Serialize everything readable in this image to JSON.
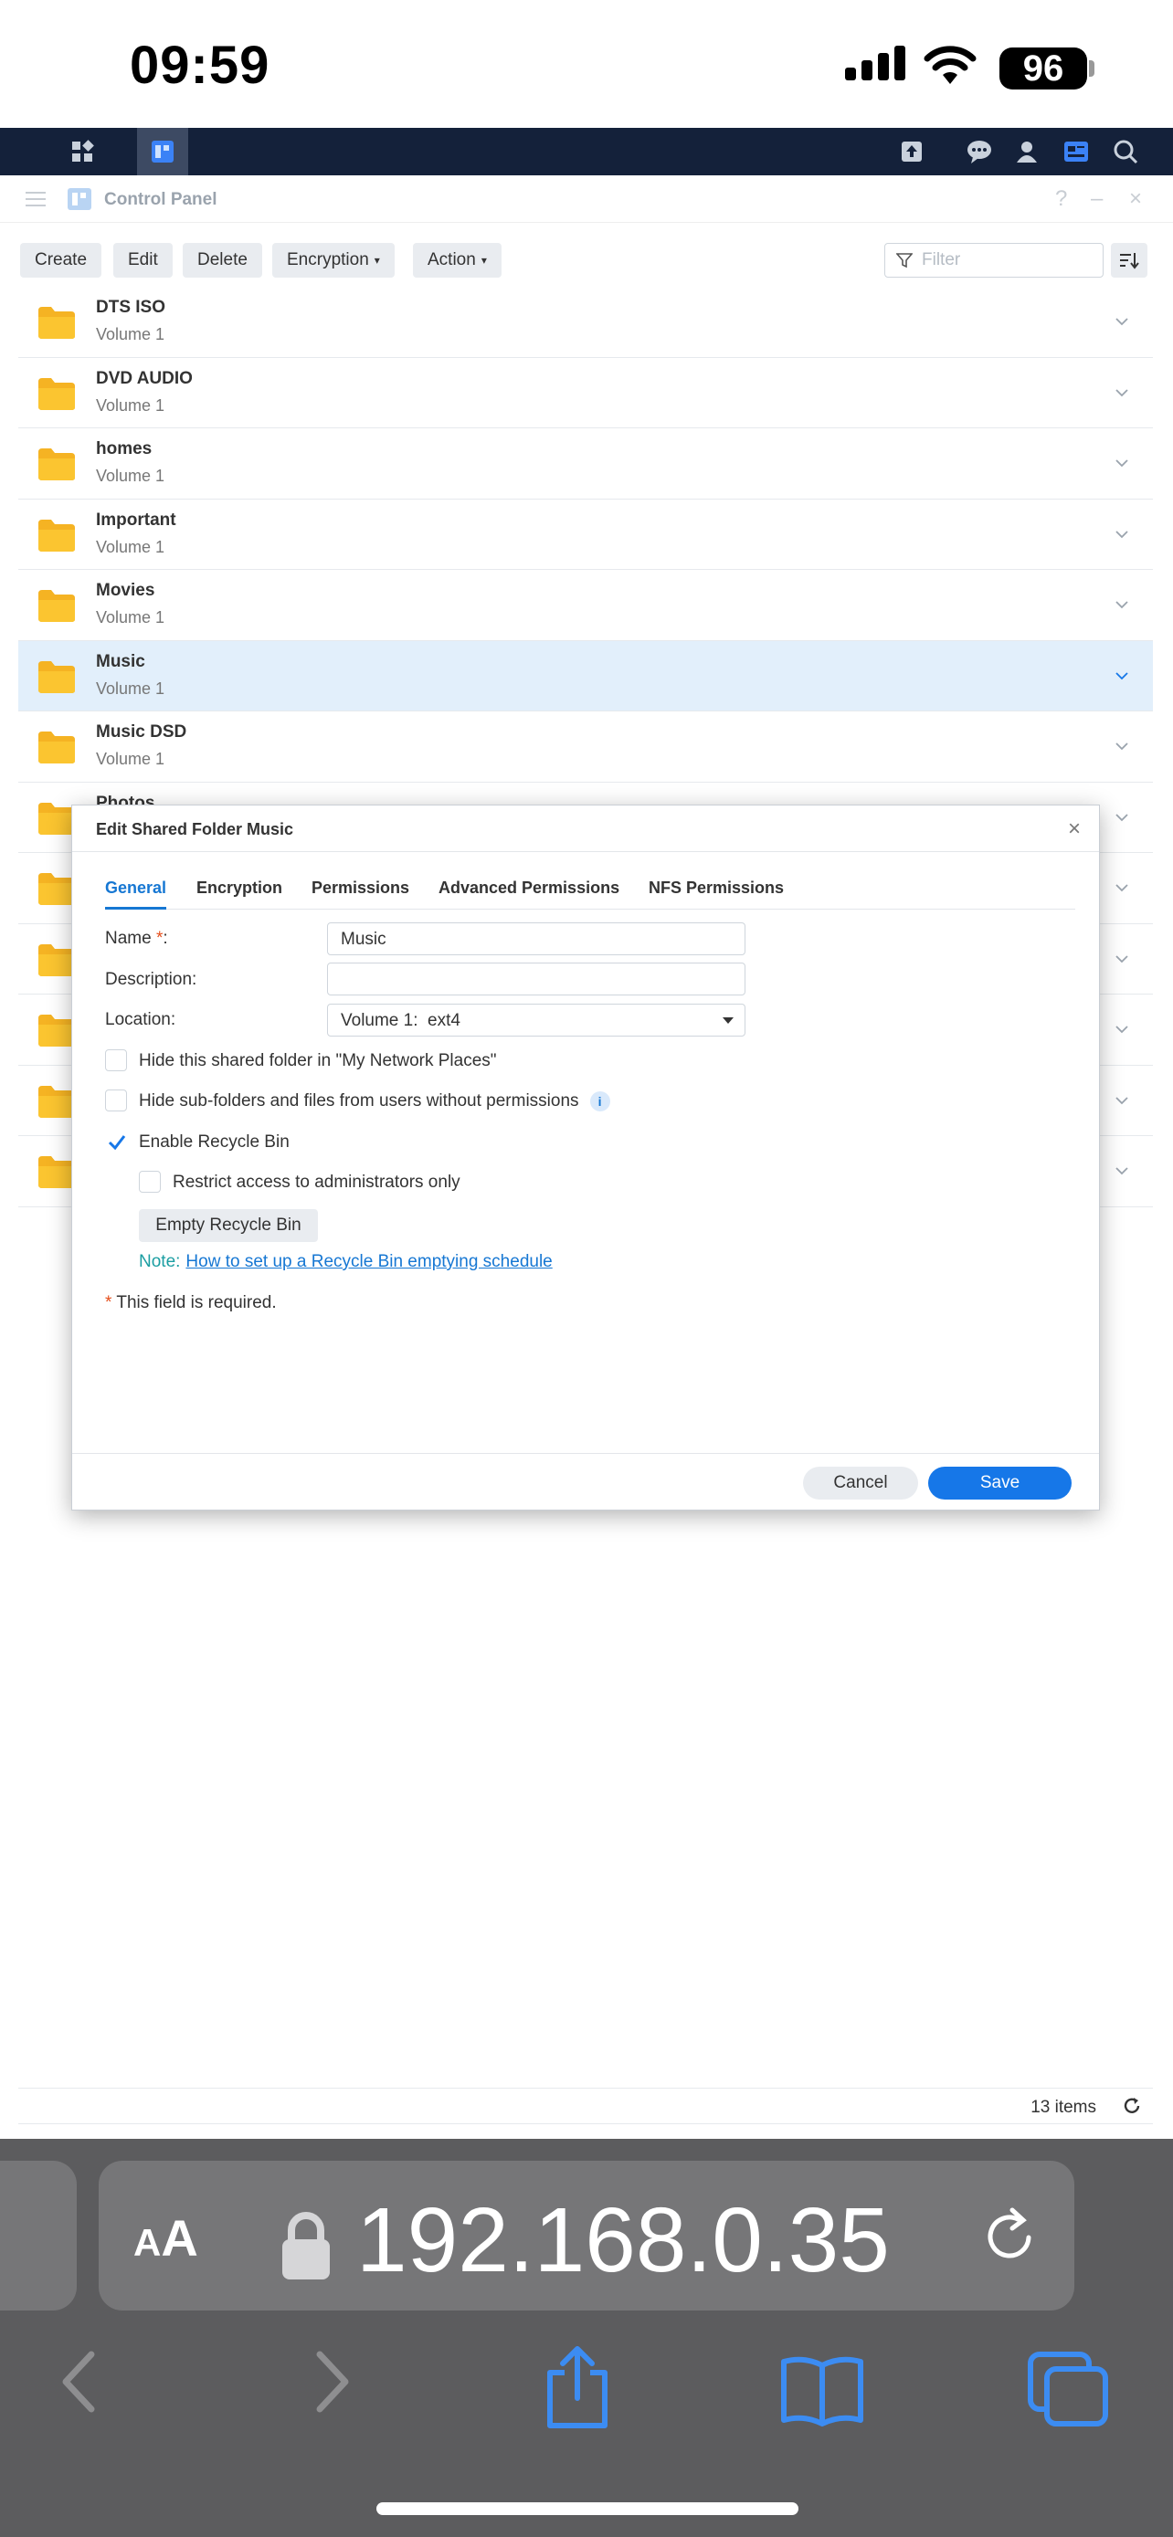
{
  "status_bar": {
    "time": "09:59",
    "battery": "96"
  },
  "control_panel": {
    "title": "Control Panel",
    "toolbar": {
      "create": "Create",
      "edit": "Edit",
      "delete": "Delete",
      "encryption": "Encryption",
      "action": "Action",
      "filter_placeholder": "Filter"
    },
    "folders": [
      {
        "name": "DTS ISO",
        "volume": "Volume 1"
      },
      {
        "name": "DVD AUDIO",
        "volume": "Volume 1"
      },
      {
        "name": "homes",
        "volume": "Volume 1"
      },
      {
        "name": "Important",
        "volume": "Volume 1"
      },
      {
        "name": "Movies",
        "volume": "Volume 1"
      },
      {
        "name": "Music",
        "volume": "Volume 1",
        "selected": true
      },
      {
        "name": "Music DSD",
        "volume": "Volume 1"
      },
      {
        "name": "Photos",
        "volume": ""
      },
      {
        "name": "",
        "volume": ""
      },
      {
        "name": "",
        "volume": ""
      },
      {
        "name": "",
        "volume": ""
      },
      {
        "name": "",
        "volume": ""
      },
      {
        "name": "",
        "volume": ""
      }
    ],
    "item_count": "13 items"
  },
  "dialog": {
    "title": "Edit Shared Folder Music",
    "tabs": [
      "General",
      "Encryption",
      "Permissions",
      "Advanced Permissions",
      "NFS Permissions"
    ],
    "active_tab": "General",
    "fields": {
      "name_label": "Name",
      "name_required_mark": "*",
      "name_colon": ":",
      "name_value": "Music",
      "description_label": "Description:",
      "description_value": "",
      "location_label": "Location:",
      "location_value": "Volume 1:  ext4"
    },
    "options": {
      "hide_network_places": {
        "label": "Hide this shared folder in \"My Network Places\"",
        "checked": false
      },
      "hide_subfolders": {
        "label": "Hide sub-folders and files from users without permissions",
        "checked": false,
        "info_icon": "i"
      },
      "enable_recycle_bin": {
        "label": "Enable Recycle Bin",
        "checked": true
      },
      "restrict_admins": {
        "label": "Restrict access to administrators only",
        "checked": false
      }
    },
    "empty_recycle_bin": "Empty Recycle Bin",
    "note_prefix": "Note:",
    "note_link": "How to set up a Recycle Bin emptying schedule",
    "required_note_mark": "*",
    "required_note": "This field is required.",
    "cancel": "Cancel",
    "save": "Save"
  },
  "safari": {
    "aa_large": "A",
    "aa_small": "A",
    "url": "192.168.0.35"
  },
  "colors": {
    "accent": "#1677e8",
    "selected_row": "#e2effb",
    "folder": "#fbc530",
    "taskbar": "#14213a",
    "safari_bar": "#5c5c5e"
  }
}
